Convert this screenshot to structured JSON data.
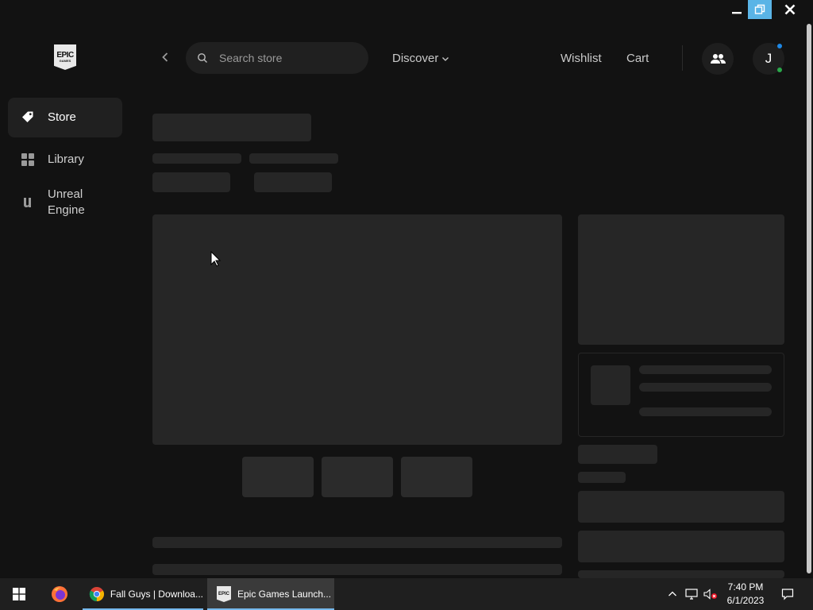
{
  "window": {
    "controls": {
      "minimize": "minimize-icon",
      "restore": "restore-icon",
      "close": "close-icon"
    }
  },
  "header": {
    "logo": {
      "line1": "EPIC",
      "line2": "GAMES"
    },
    "search_placeholder": "Search store",
    "discover_label": "Discover",
    "wishlist_label": "Wishlist",
    "cart_label": "Cart",
    "avatar_initial": "J"
  },
  "sidebar": {
    "items": [
      {
        "label": "Store",
        "icon": "tag-icon",
        "active": true
      },
      {
        "label": "Library",
        "icon": "grid-icon",
        "active": false
      },
      {
        "label": "Unreal Engine",
        "icon": "unreal-icon",
        "active": false
      }
    ]
  },
  "taskbar": {
    "apps": [
      {
        "label": "Fall Guys | Downloa...",
        "icon": "chrome-icon"
      },
      {
        "label": "Epic Games Launch...",
        "icon": "epic-games-icon",
        "active": true
      }
    ],
    "time": "7:40 PM",
    "date": "6/1/2023"
  },
  "colors": {
    "background": "#121212",
    "panel": "#202020",
    "skeleton": "#262626",
    "taskbar": "#1f1f1f",
    "restore_highlight": "#5ab4e6",
    "status_green": "#2aa84a",
    "notification_blue": "#1e88e5"
  }
}
